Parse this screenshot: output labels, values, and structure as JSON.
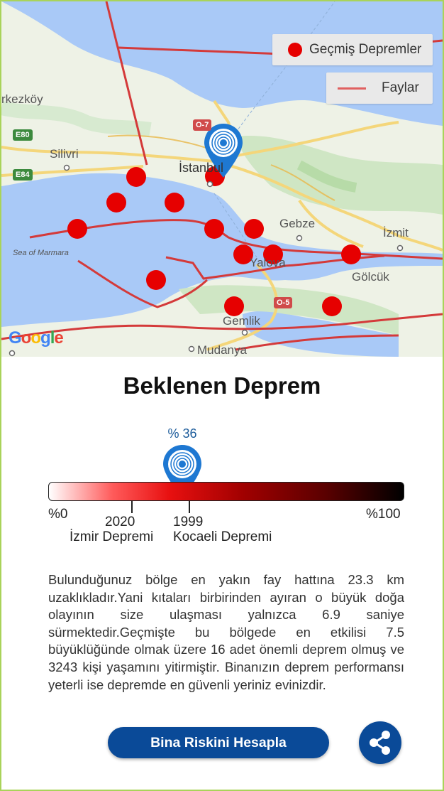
{
  "map": {
    "legend_quakes": "Geçmiş Depremler",
    "legend_faults": "Faylar",
    "places": {
      "cerkezkoy": "rkezköy",
      "silivri": "Silivri",
      "istanbul": "İstanbul",
      "gebze": "Gebze",
      "izmit": "İzmit",
      "golcuk": "Gölcük",
      "yalova": "Yalova",
      "gemlik": "Gemlik",
      "mudanya": "Mudanya",
      "sea": "Sea of Marmara"
    },
    "roads": {
      "e80": "E80",
      "e84": "E84",
      "o7": "O-7",
      "o5": "O-5"
    },
    "google": [
      "G",
      "o",
      "o",
      "g",
      "l",
      "e"
    ],
    "colors": {
      "quake": "#e60000",
      "fault": "#d43a3a",
      "pin": "#1e78d2"
    }
  },
  "risk": {
    "title": "Beklenen Deprem",
    "percent_label": "% 36",
    "percent_value": 36,
    "scale_min": "%0",
    "scale_max": "%100",
    "mark_2020_year": "2020",
    "mark_2020_name": "İzmir Depremi",
    "mark_1999_year": "1999",
    "mark_1999_name": "Kocaeli Depremi"
  },
  "description": "Bulunduğunuz bölge en yakın fay hattına 23.3 km uzaklıkladır.Yani kıtaları birbirinden ayıran o büyük doğa olayının size ulaşması yalnızca 6.9 saniye sürmektedir.Geçmişte bu bölgede en etkilisi 7.5 büyüklüğünde olmak üzere 16 adet önemli deprem olmuş ve 3243 kişi yaşamını yitirmiştir. Binanızın deprem performansı yeterli ise depremde en güvenli yeriniz evinizdir.",
  "actions": {
    "calculate_label": "Bina Riskini Hesapla",
    "share_icon": "share-icon"
  }
}
